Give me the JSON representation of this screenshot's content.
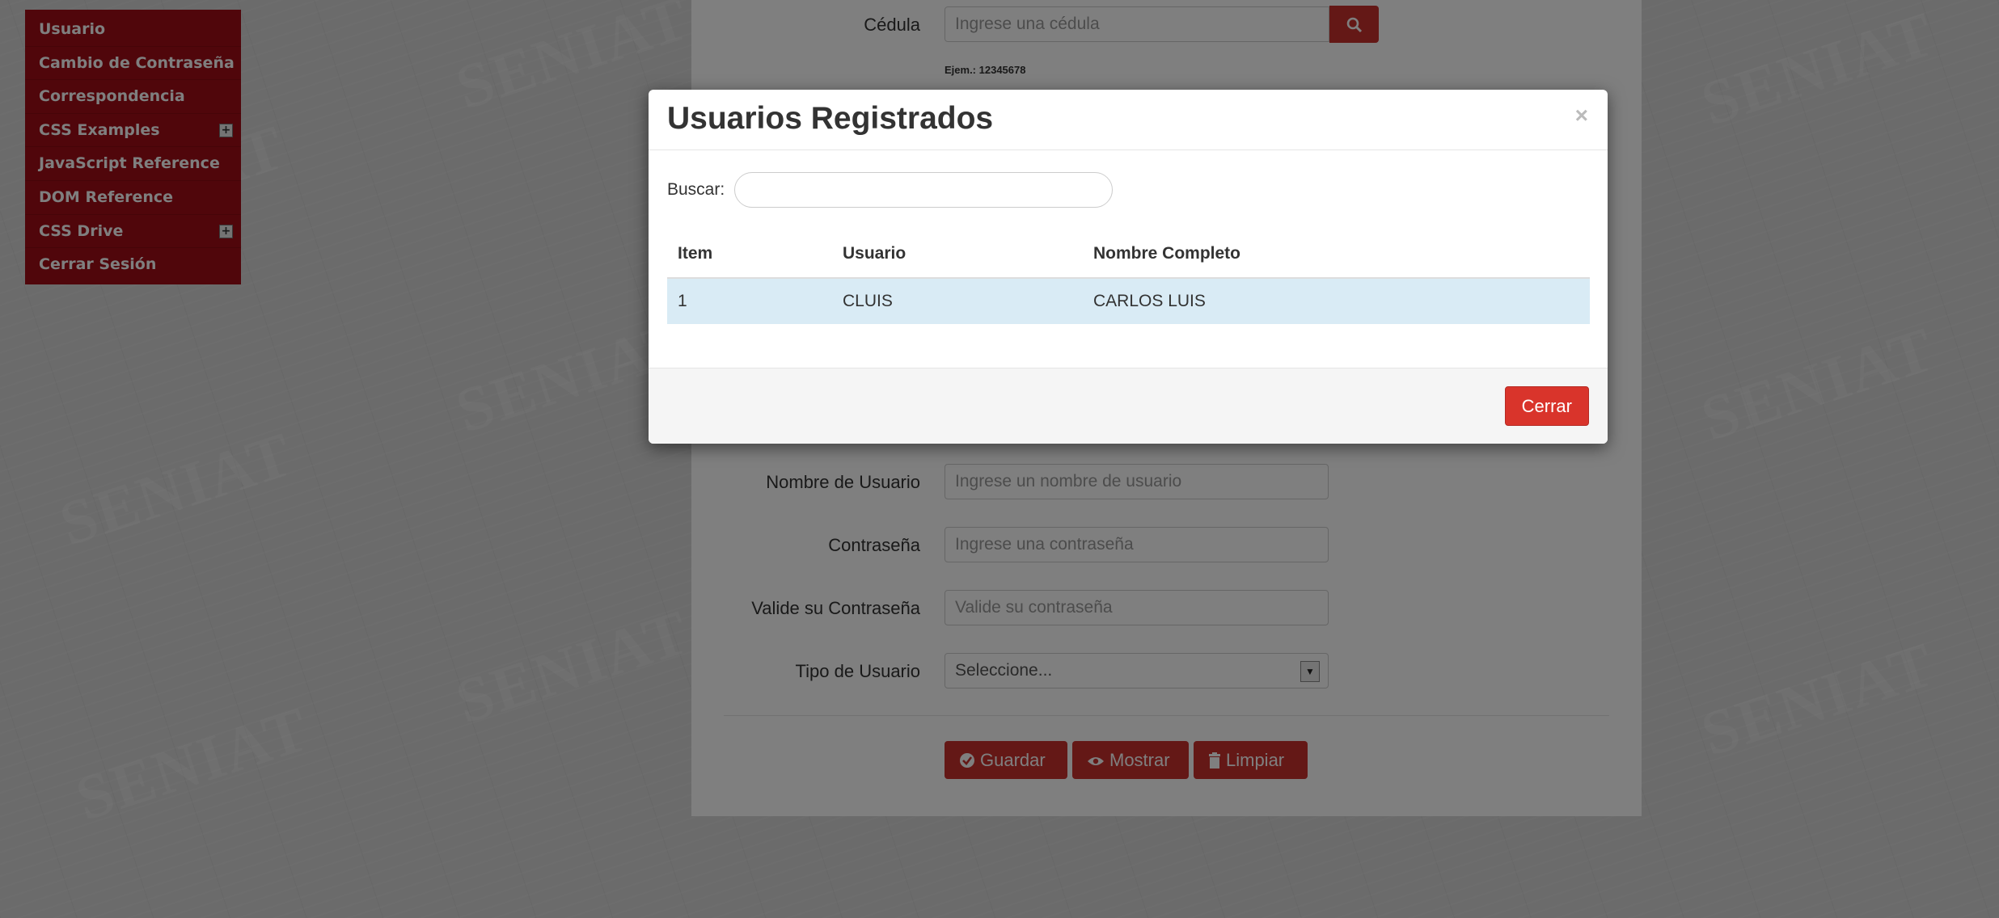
{
  "sidebar": {
    "items": [
      {
        "label": "Usuario",
        "has_submenu": false
      },
      {
        "label": "Cambio de Contraseña",
        "has_submenu": false
      },
      {
        "label": "Correspondencia",
        "has_submenu": false
      },
      {
        "label": "CSS Examples",
        "has_submenu": true
      },
      {
        "label": "JavaScript Reference",
        "has_submenu": false
      },
      {
        "label": "DOM Reference",
        "has_submenu": false
      },
      {
        "label": "CSS Drive",
        "has_submenu": true
      },
      {
        "label": "Cerrar Sesión",
        "has_submenu": false
      }
    ],
    "expand_symbol": "+"
  },
  "watermark": "SENIAT",
  "form": {
    "cedula": {
      "label": "Cédula",
      "placeholder": "Ingrese una cédula",
      "hint": "Ejem.: 12345678"
    },
    "username": {
      "label": "Nombre de Usuario",
      "placeholder": "Ingrese un nombre de usuario"
    },
    "password": {
      "label": "Contraseña",
      "placeholder": "Ingrese una contraseña"
    },
    "confirm": {
      "label": "Valide su Contraseña",
      "placeholder": "Valide su contraseña"
    },
    "user_type": {
      "label": "Tipo de Usuario",
      "selected": "Seleccione..."
    },
    "buttons": {
      "save": "Guardar",
      "show": "Mostrar",
      "clear": "Limpiar"
    }
  },
  "modal": {
    "title": "Usuarios Registrados",
    "close_symbol": "×",
    "search_label": "Buscar:",
    "search_value": "",
    "columns": [
      "Item",
      "Usuario",
      "Nombre Completo"
    ],
    "rows": [
      {
        "item": "1",
        "usuario": "CLUIS",
        "nombre": "CARLOS LUIS"
      }
    ],
    "close_button": "Cerrar"
  },
  "colors": {
    "brand_red": "#c9302c",
    "menu_bg": "#a10c16",
    "row_highlight": "#d9ebf5"
  }
}
